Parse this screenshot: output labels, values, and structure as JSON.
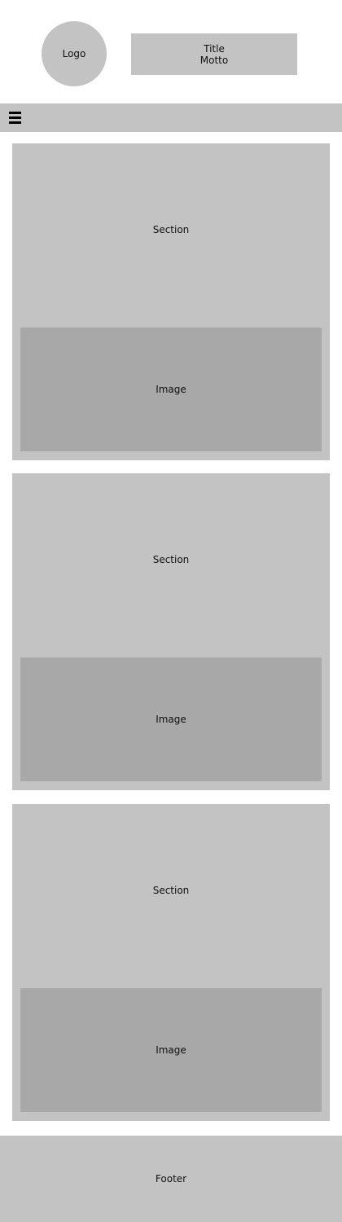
{
  "header": {
    "logo_label": "Logo",
    "title": "Title",
    "motto": "Motto"
  },
  "nav": {
    "menu_icon": "hamburger-menu-icon"
  },
  "sections": [
    {
      "label": "Section",
      "image_label": "Image"
    },
    {
      "label": "Section",
      "image_label": "Image"
    },
    {
      "label": "Section",
      "image_label": "Image"
    }
  ],
  "footer": {
    "label": "Footer"
  },
  "colors": {
    "background": "#ffffff",
    "block": "#c3c3c3",
    "image": "#a8a8a8",
    "text": "#111111",
    "icon": "#000000"
  }
}
